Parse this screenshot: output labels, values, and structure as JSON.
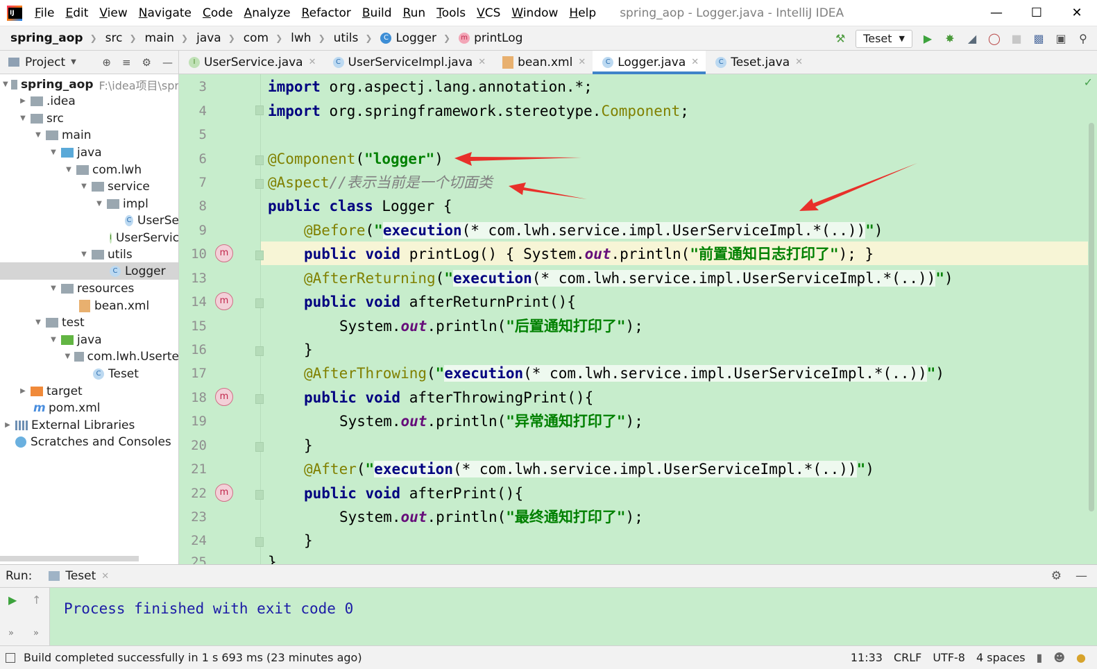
{
  "window": {
    "title": "spring_aop - Logger.java - IntelliJ IDEA",
    "menu": [
      "File",
      "Edit",
      "View",
      "Navigate",
      "Code",
      "Analyze",
      "Refactor",
      "Build",
      "Run",
      "Tools",
      "VCS",
      "Window",
      "Help"
    ]
  },
  "breadcrumb": [
    "spring_aop",
    "src",
    "main",
    "java",
    "com",
    "lwh",
    "utils",
    "Logger",
    "printLog"
  ],
  "toolbar": {
    "run_config": "Teset"
  },
  "project_panel": {
    "title": "Project",
    "tree": [
      {
        "label": "spring_aop",
        "extra": "F:\\idea项目\\spr",
        "bold": true
      },
      {
        "label": ".idea"
      },
      {
        "label": "src"
      },
      {
        "label": "main"
      },
      {
        "label": "java"
      },
      {
        "label": "com.lwh"
      },
      {
        "label": "service"
      },
      {
        "label": "impl"
      },
      {
        "label": "UserSe"
      },
      {
        "label": "UserServic"
      },
      {
        "label": "utils"
      },
      {
        "label": "Logger"
      },
      {
        "label": "resources"
      },
      {
        "label": "bean.xml"
      },
      {
        "label": "test"
      },
      {
        "label": "java"
      },
      {
        "label": "com.lwh.Userte"
      },
      {
        "label": "Teset"
      },
      {
        "label": "target"
      },
      {
        "label": "pom.xml"
      },
      {
        "label": "External Libraries"
      },
      {
        "label": "Scratches and Consoles"
      }
    ]
  },
  "tabs": [
    {
      "label": "UserService.java",
      "icon": "I"
    },
    {
      "label": "UserServiceImpl.java",
      "icon": "C"
    },
    {
      "label": "bean.xml",
      "icon": "xml"
    },
    {
      "label": "Logger.java",
      "icon": "C",
      "active": true
    },
    {
      "label": "Teset.java",
      "icon": "C"
    }
  ],
  "editor": {
    "line_numbers": [
      "3",
      "4",
      "5",
      "6",
      "7",
      "8",
      "9",
      "10",
      "13",
      "14",
      "15",
      "16",
      "17",
      "18",
      "19",
      "20",
      "21",
      "22",
      "23",
      "24",
      "25"
    ],
    "code": {
      "l3_kw": "import",
      "l3_rest": " org.aspectj.lang.annotation.*;",
      "l4_kw": "import",
      "l4_rest": " org.springframework.stereotype.",
      "l4_ann": "Component",
      "l4_end": ";",
      "l6_ann": "@Component",
      "l6_p1": "(",
      "l6_str": "\"logger\"",
      "l6_p2": ")",
      "l7_ann": "@Aspect",
      "l7_cm": "//表示当前是一个切面类",
      "l8_kw": "public class",
      "l8_rest": " Logger {",
      "l9_ann": "@Before",
      "l9_p1": "(",
      "l9_q1": "\"",
      "l9_exec": "execution",
      "l9_mid": "(* com.lwh.service.impl.UserServiceImpl.*(..))",
      "l9_q2": "\"",
      "l9_p2": ")",
      "l10_kw": "public void",
      "l10_rest": " printLog() { System.",
      "l10_out": "out",
      "l10_p": ".println(",
      "l10_str": "\"前置通知日志打印了\"",
      "l10_end": "); }",
      "l13_ann": "@AfterReturning",
      "l13_p1": "(",
      "l13_q1": "\"",
      "l13_exec": "execution",
      "l13_mid": "(* com.lwh.service.impl.UserServiceImpl.*(..))",
      "l13_q2": "\"",
      "l13_p2": ")",
      "l14_kw": "public void",
      "l14_rest": " afterReturnPrint(){",
      "l15_a": "System.",
      "l15_out": "out",
      "l15_p": ".println(",
      "l15_str": "\"后置通知打印了\"",
      "l15_end": ");",
      "l16": "}",
      "l17_ann": "@AfterThrowing",
      "l17_p1": "(",
      "l17_q1": "\"",
      "l17_exec": "execution",
      "l17_mid": "(* com.lwh.service.impl.UserServiceImpl.*(..))",
      "l17_q2": "\"",
      "l17_p2": ")",
      "l18_kw": "public void",
      "l18_rest": " afterThrowingPrint(){",
      "l19_a": "System.",
      "l19_out": "out",
      "l19_p": ".println(",
      "l19_str": "\"异常通知打印了\"",
      "l19_end": ");",
      "l20": "}",
      "l21_ann": "@After",
      "l21_p1": "(",
      "l21_q1": "\"",
      "l21_exec": "execution",
      "l21_mid": "(* com.lwh.service.impl.UserServiceImpl.*(..))",
      "l21_q2": "\"",
      "l21_p2": ")",
      "l22_kw": "public void",
      "l22_rest": " afterPrint(){",
      "l23_a": "System.",
      "l23_out": "out",
      "l23_p": ".println(",
      "l23_str": "\"最终通知打印了\"",
      "l23_end": ");",
      "l24": "}",
      "l25": "}"
    }
  },
  "run_panel": {
    "label": "Run:",
    "tab": "Teset",
    "output": "Process finished with exit code 0"
  },
  "status_bar": {
    "message": "Build completed successfully in 1 s 693 ms (23 minutes ago)",
    "position": "11:33",
    "line_sep": "CRLF",
    "encoding": "UTF-8",
    "indent": "4 spaces"
  },
  "colors": {
    "editor_bg": "#c7edcc",
    "keyword": "#000080",
    "annotation": "#808000",
    "string": "#008000",
    "arrow": "#e8302a"
  }
}
